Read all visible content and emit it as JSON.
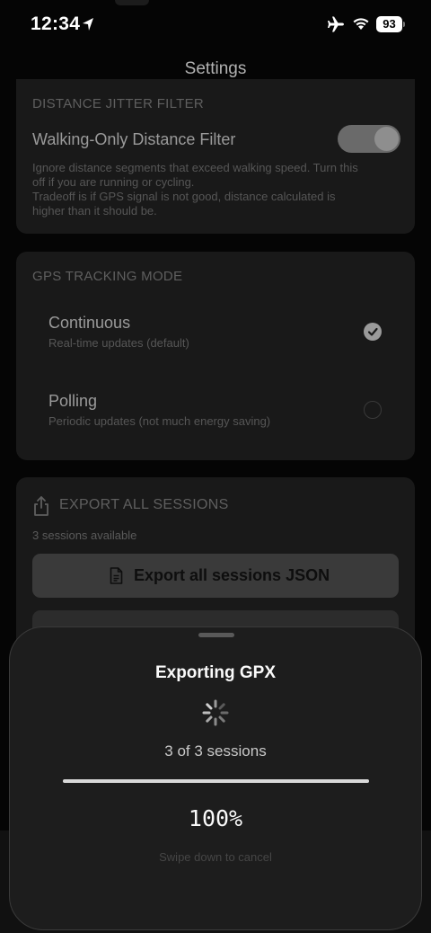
{
  "status_bar": {
    "time": "12:34",
    "battery": "93"
  },
  "nav": {
    "title": "Settings"
  },
  "distance_filter": {
    "section_title": "DISTANCE JITTER FILTER",
    "toggle_label": "Walking-Only Distance Filter",
    "toggle_on": true,
    "description_line1": "Ignore distance segments that exceed walking speed. Turn this",
    "description_line2": "off if you are running or cycling.",
    "description_line3": "Tradeoff is if GPS signal is not good, distance calculated is",
    "description_line4": "higher than it should be."
  },
  "gps_mode": {
    "section_title": "GPS TRACKING MODE",
    "options": [
      {
        "title": "Continuous",
        "subtitle": "Real-time updates (default)",
        "selected": true
      },
      {
        "title": "Polling",
        "subtitle": "Periodic updates (not much energy saving)",
        "selected": false
      }
    ]
  },
  "export": {
    "section_title": "EXPORT ALL SESSIONS",
    "sessions_available": "3 sessions available",
    "json_button_label": "Export all sessions JSON"
  },
  "sheet": {
    "title": "Exporting GPX",
    "sessions_count": "3 of 3 sessions",
    "progress_fraction": 1.0,
    "percent_label": "100%",
    "hint": "Swipe down to cancel"
  },
  "colors": {
    "background": "#050505",
    "card": "#191919",
    "sheet": "#1d1d1d",
    "progress_fill": "#d9d9d9"
  },
  "icons": [
    "location-arrow-icon",
    "airplane-icon",
    "wifi-icon",
    "share-icon",
    "document-icon",
    "checkmark-icon",
    "spinner-icon"
  ]
}
